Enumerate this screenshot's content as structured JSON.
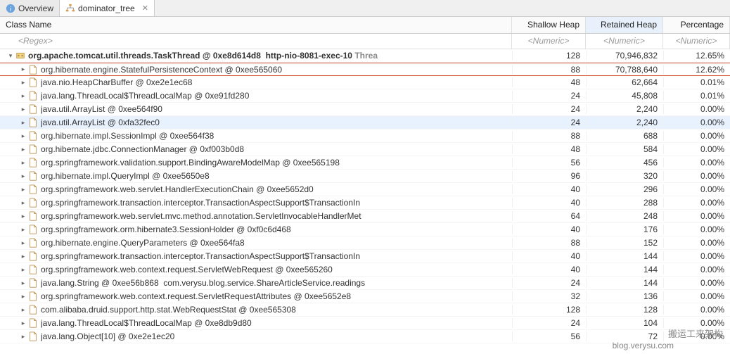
{
  "tabs": [
    {
      "icon": "info",
      "label": "Overview"
    },
    {
      "icon": "tree",
      "label": "dominator_tree",
      "close": "✕"
    }
  ],
  "headers": {
    "name": "Class Name",
    "shallow": "Shallow Heap",
    "retained": "Retained Heap",
    "percent": "Percentage"
  },
  "filters": {
    "name": "<Regex>",
    "shallow": "<Numeric>",
    "retained": "<Numeric>",
    "percent": "<Numeric>"
  },
  "rows": [
    {
      "depth": 0,
      "expander": "▾",
      "icon": "thread",
      "name": "org.apache.tomcat.util.threads.TaskThread @ 0xe8d614d8",
      "suffix": "http-nio-8081-exec-10",
      "threadLabel": "Threa",
      "shallow": "128",
      "retained": "70,946,832",
      "percent": "12.65%",
      "bold": true
    },
    {
      "depth": 1,
      "expander": "▸",
      "icon": "file",
      "name": "org.hibernate.engine.StatefulPersistenceContext @ 0xee565060",
      "shallow": "88",
      "retained": "70,788,640",
      "percent": "12.62%",
      "red": true
    },
    {
      "depth": 1,
      "expander": "▸",
      "icon": "file",
      "name": "java.nio.HeapCharBuffer @ 0xe2e1ec68",
      "shallow": "48",
      "retained": "62,664",
      "percent": "0.01%"
    },
    {
      "depth": 1,
      "expander": "▸",
      "icon": "file",
      "name": "java.lang.ThreadLocal$ThreadLocalMap @ 0xe91fd280",
      "shallow": "24",
      "retained": "45,808",
      "percent": "0.01%"
    },
    {
      "depth": 1,
      "expander": "▸",
      "icon": "file",
      "name": "java.util.ArrayList @ 0xee564f90",
      "shallow": "24",
      "retained": "2,240",
      "percent": "0.00%"
    },
    {
      "depth": 1,
      "expander": "▸",
      "icon": "file",
      "name": "java.util.ArrayList @ 0xfa32fec0",
      "shallow": "24",
      "retained": "2,240",
      "percent": "0.00%",
      "selected": true
    },
    {
      "depth": 1,
      "expander": "▸",
      "icon": "file",
      "name": "org.hibernate.impl.SessionImpl @ 0xee564f38",
      "shallow": "88",
      "retained": "688",
      "percent": "0.00%"
    },
    {
      "depth": 1,
      "expander": "▸",
      "icon": "file",
      "name": "org.hibernate.jdbc.ConnectionManager @ 0xf003b0d8",
      "shallow": "48",
      "retained": "584",
      "percent": "0.00%"
    },
    {
      "depth": 1,
      "expander": "▸",
      "icon": "file",
      "name": "org.springframework.validation.support.BindingAwareModelMap @ 0xee565198",
      "shallow": "56",
      "retained": "456",
      "percent": "0.00%"
    },
    {
      "depth": 1,
      "expander": "▸",
      "icon": "file",
      "name": "org.hibernate.impl.QueryImpl @ 0xee5650e8",
      "shallow": "96",
      "retained": "320",
      "percent": "0.00%"
    },
    {
      "depth": 1,
      "expander": "▸",
      "icon": "file",
      "name": "org.springframework.web.servlet.HandlerExecutionChain @ 0xee5652d0",
      "shallow": "40",
      "retained": "296",
      "percent": "0.00%"
    },
    {
      "depth": 1,
      "expander": "▸",
      "icon": "file",
      "name": "org.springframework.transaction.interceptor.TransactionAspectSupport$TransactionIn",
      "shallow": "40",
      "retained": "288",
      "percent": "0.00%"
    },
    {
      "depth": 1,
      "expander": "▸",
      "icon": "file",
      "name": "org.springframework.web.servlet.mvc.method.annotation.ServletInvocableHandlerMet",
      "shallow": "64",
      "retained": "248",
      "percent": "0.00%"
    },
    {
      "depth": 1,
      "expander": "▸",
      "icon": "file",
      "name": "org.springframework.orm.hibernate3.SessionHolder @ 0xf0c6d468",
      "shallow": "40",
      "retained": "176",
      "percent": "0.00%"
    },
    {
      "depth": 1,
      "expander": "▸",
      "icon": "file",
      "name": "org.hibernate.engine.QueryParameters @ 0xee564fa8",
      "shallow": "88",
      "retained": "152",
      "percent": "0.00%"
    },
    {
      "depth": 1,
      "expander": "▸",
      "icon": "file",
      "name": "org.springframework.transaction.interceptor.TransactionAspectSupport$TransactionIn",
      "shallow": "40",
      "retained": "144",
      "percent": "0.00%"
    },
    {
      "depth": 1,
      "expander": "▸",
      "icon": "file",
      "name": "org.springframework.web.context.request.ServletWebRequest @ 0xee565260",
      "shallow": "40",
      "retained": "144",
      "percent": "0.00%"
    },
    {
      "depth": 1,
      "expander": "▸",
      "icon": "file",
      "name": "java.lang.String @ 0xee56b868",
      "suffix": "com.verysu.blog.service.ShareArticleService.readings",
      "shallow": "24",
      "retained": "144",
      "percent": "0.00%"
    },
    {
      "depth": 1,
      "expander": "▸",
      "icon": "file",
      "name": "org.springframework.web.context.request.ServletRequestAttributes @ 0xee5652e8",
      "shallow": "32",
      "retained": "136",
      "percent": "0.00%"
    },
    {
      "depth": 1,
      "expander": "▸",
      "icon": "file",
      "name": "com.alibaba.druid.support.http.stat.WebRequestStat @ 0xee565308",
      "shallow": "128",
      "retained": "128",
      "percent": "0.00%"
    },
    {
      "depth": 1,
      "expander": "▸",
      "icon": "file",
      "name": "java.lang.ThreadLocal$ThreadLocalMap @ 0xe8db9d80",
      "shallow": "24",
      "retained": "104",
      "percent": "0.00%"
    },
    {
      "depth": 1,
      "expander": "▸",
      "icon": "file",
      "name": "java.lang.Object[10] @ 0xe2e1ec20",
      "shallow": "56",
      "retained": "72",
      "percent": "0.00%"
    }
  ],
  "watermark1": "搬运工来架构",
  "watermark2": "blog.verysu.com"
}
